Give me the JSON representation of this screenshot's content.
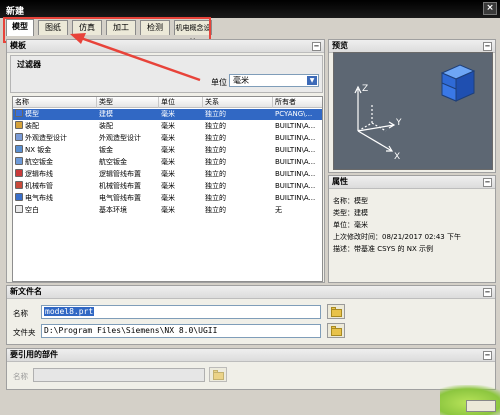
{
  "window": {
    "title": "新建",
    "close_glyph": "×"
  },
  "tabs": [
    {
      "label": "模型",
      "active": true
    },
    {
      "label": "图纸",
      "active": false
    },
    {
      "label": "仿真",
      "active": false
    },
    {
      "label": "加工",
      "active": false
    },
    {
      "label": "检测",
      "active": false
    },
    {
      "label": "机电概念设计",
      "active": false
    }
  ],
  "template_section": {
    "title": "模板",
    "collapse_glyph": "−"
  },
  "filter": {
    "title": "过滤器",
    "unit_label": "单位",
    "unit_value": "毫米"
  },
  "table": {
    "columns": [
      "名称",
      "类型",
      "单位",
      "关系",
      "所有者"
    ],
    "rows": [
      {
        "name": "模型",
        "type": "建模",
        "unit": "毫米",
        "relation": "独立的",
        "owner": "PCYANG\\...",
        "icon": "model-icon",
        "icon_color": "#3a6fd6",
        "selected": true
      },
      {
        "name": "装配",
        "type": "装配",
        "unit": "毫米",
        "relation": "独立的",
        "owner": "BUILTIN\\A...",
        "icon": "assembly-icon",
        "icon_color": "#d6a23a",
        "selected": false
      },
      {
        "name": "外观造型设计",
        "type": "外观造型设计",
        "unit": "毫米",
        "relation": "独立的",
        "owner": "BUILTIN\\A...",
        "icon": "shape-studio-icon",
        "icon_color": "#7a9bd6",
        "selected": false
      },
      {
        "name": "NX 钣金",
        "type": "钣金",
        "unit": "毫米",
        "relation": "独立的",
        "owner": "BUILTIN\\A...",
        "icon": "sheet-metal-icon",
        "icon_color": "#5a8fd0",
        "selected": false
      },
      {
        "name": "航空钣金",
        "type": "航空钣金",
        "unit": "毫米",
        "relation": "独立的",
        "owner": "BUILTIN\\A...",
        "icon": "aero-sheet-metal-icon",
        "icon_color": "#6d9ad8",
        "selected": false
      },
      {
        "name": "逻辑布线",
        "type": "逻辑管线布置",
        "unit": "毫米",
        "relation": "独立的",
        "owner": "BUILTIN\\A...",
        "icon": "logical-routing-icon",
        "icon_color": "#c93a3a",
        "selected": false
      },
      {
        "name": "机械布管",
        "type": "机械管线布置",
        "unit": "毫米",
        "relation": "独立的",
        "owner": "BUILTIN\\A...",
        "icon": "mechanical-routing-icon",
        "icon_color": "#c94a3a",
        "selected": false
      },
      {
        "name": "电气布线",
        "type": "电气管线布置",
        "unit": "毫米",
        "relation": "独立的",
        "owner": "BUILTIN\\A...",
        "icon": "electrical-routing-icon",
        "icon_color": "#3a6fc9",
        "selected": false
      },
      {
        "name": "空白",
        "type": "基本环境",
        "unit": "毫米",
        "relation": "独立的",
        "owner": "无",
        "icon": "blank-icon",
        "icon_color": "#e8e8e8",
        "selected": false
      }
    ]
  },
  "preview": {
    "title": "预览",
    "axis_z": "Z",
    "axis_y": "Y",
    "axis_x": "X"
  },
  "properties": {
    "title": "属性",
    "lines": [
      "名称：模型",
      "类型：建模",
      "单位：毫米",
      "上次修改时间：08/21/2017 02:43 下午",
      "描述：带基准 CSYS 的 NX 示例"
    ]
  },
  "new_file": {
    "title": "新文件名",
    "name_label": "名称",
    "name_value": "model8.prt",
    "folder_label": "文件夹",
    "folder_value": "D:\\Program Files\\Siemens\\NX 8.0\\UGII"
  },
  "referenced_part": {
    "title": "要引用的部件",
    "name_label": "名称"
  },
  "colors": {
    "accent_red": "#e8433a",
    "selection_blue": "#3168c4",
    "preview_bg": "#5d6773"
  }
}
